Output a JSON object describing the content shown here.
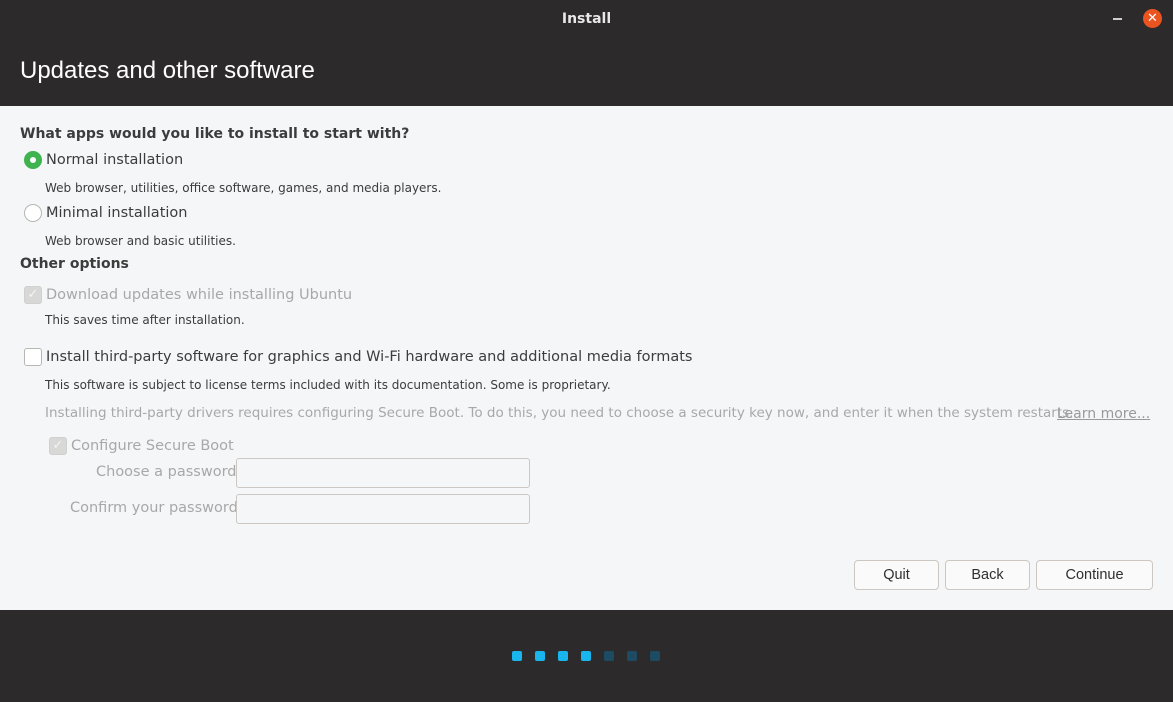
{
  "window": {
    "title": "Install",
    "close_glyph": "✕"
  },
  "header": {
    "title": "Updates and other software"
  },
  "apps_section": {
    "heading": "What apps would you like to install to start with?",
    "normal": {
      "label": "Normal installation",
      "description": "Web browser, utilities, office software, games, and media players.",
      "selected": true
    },
    "minimal": {
      "label": "Minimal installation",
      "description": "Web browser and basic utilities.",
      "selected": false
    }
  },
  "other_options": {
    "heading": "Other options",
    "download_updates": {
      "label": "Download updates while installing Ubuntu",
      "description": "This saves time after installation.",
      "checked": true,
      "enabled": false
    },
    "third_party": {
      "label": "Install third-party software for graphics and Wi-Fi hardware and additional media formats",
      "description": "This software is subject to license terms included with its documentation. Some is proprietary.",
      "checked": false,
      "enabled": true
    },
    "secure_boot_note": "Installing third-party drivers requires configuring Secure Boot. To do this, you need to choose a security key now, and enter it when the system restarts.",
    "learn_more": "Learn more...",
    "secure_boot": {
      "label": "Configure Secure Boot",
      "checked": true,
      "enabled": false,
      "password_label": "Choose a password:",
      "confirm_label": "Confirm your password:",
      "password_value": "",
      "confirm_value": ""
    }
  },
  "buttons": {
    "quit": "Quit",
    "back": "Back",
    "continue": "Continue"
  },
  "progress": {
    "steps_total": 7,
    "steps_completed": 4,
    "active_color": "#19b6ee",
    "inactive_color": "#1c4b63"
  },
  "colors": {
    "titlebar": "#2c2a2b",
    "close_button": "#e95420",
    "radio_selected": "#3eb34f"
  }
}
